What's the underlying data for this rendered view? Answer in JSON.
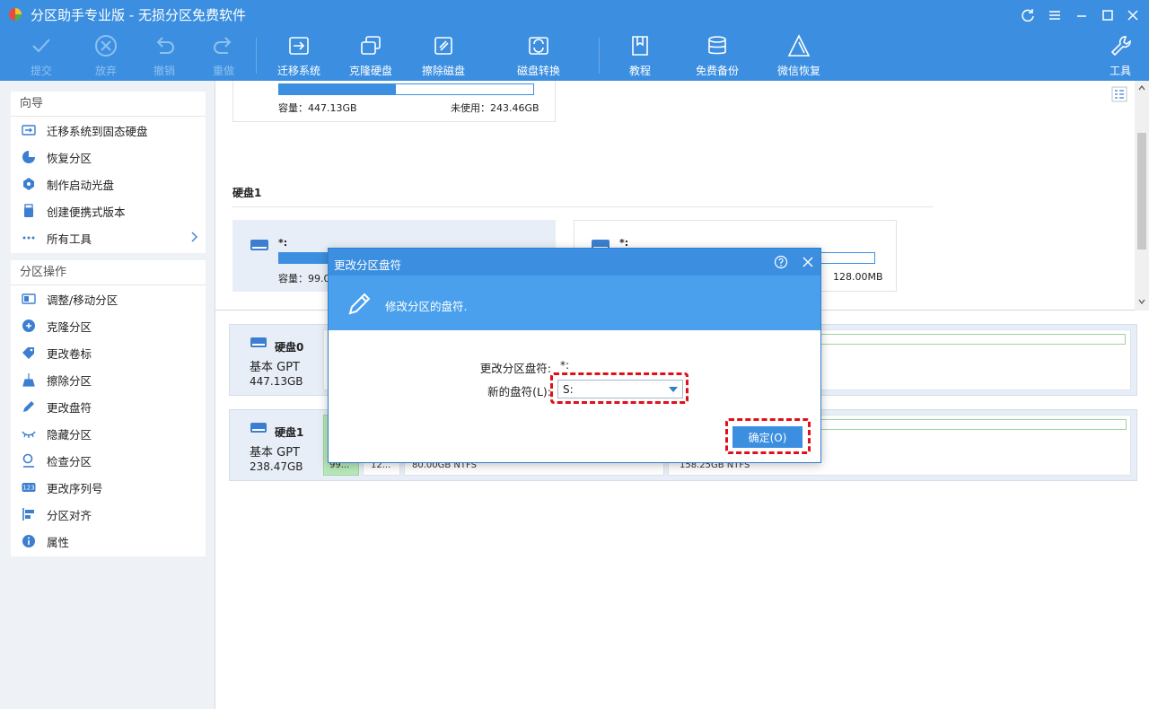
{
  "app": {
    "title": "分区助手专业版 - 无损分区免费软件"
  },
  "toolbar": {
    "commit": "提交",
    "discard": "放弃",
    "undo": "撤销",
    "redo": "重做",
    "migrate": "迁移系统",
    "clone": "克隆硬盘",
    "wipe": "擦除磁盘",
    "convert": "磁盘转换",
    "tutorial": "教程",
    "backup": "免费备份",
    "wechat": "微信恢复",
    "tools": "工具"
  },
  "wizard": {
    "title": "向导",
    "items": [
      "迁移系统到固态硬盘",
      "恢复分区",
      "制作启动光盘",
      "创建便携式版本",
      "所有工具"
    ]
  },
  "ops": {
    "title": "分区操作",
    "items": [
      "调整/移动分区",
      "克隆分区",
      "更改卷标",
      "擦除分区",
      "更改盘符",
      "隐藏分区",
      "检查分区",
      "更改序列号",
      "分区对齐",
      "属性"
    ]
  },
  "upper": {
    "card0": {
      "capacity": "容量：447.13GB",
      "unused": "未使用：243.46GB",
      "fill_ratio": 0.46
    },
    "disk1_label": "硬盘1",
    "card1": {
      "name": "*:",
      "capacity": "容量：99.0",
      "fill_ratio": 1.0
    },
    "card2": {
      "name": "*:",
      "size": "128.00MB",
      "fill_ratio": 0.25
    }
  },
  "lower": {
    "disk0": {
      "name": "硬盘0",
      "type": "基本 GPT",
      "size": "447.13GB"
    },
    "disk1": {
      "name": "硬盘1",
      "type": "基本 GPT",
      "size": "238.47GB",
      "parts": [
        "99...",
        "12...",
        "80.00GB NTFS",
        "158.25GB NTFS"
      ]
    }
  },
  "dialog": {
    "title": "更改分区盘符",
    "subtitle": "修改分区的盘符.",
    "current_label": "更改分区盘符:",
    "current_value": "*:",
    "new_label": "新的盘符(L):",
    "new_value": "S:",
    "ok": "确定(O)"
  },
  "colors": {
    "accent": "#3c8fe0",
    "highlight": "#e0101a"
  }
}
